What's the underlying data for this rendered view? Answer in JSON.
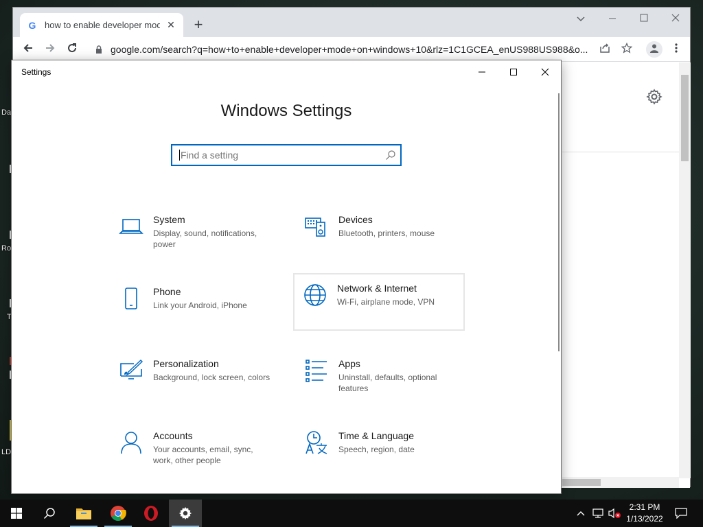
{
  "desktop": {
    "labels": [
      "Da",
      "Ro",
      "T",
      "LD"
    ]
  },
  "browser": {
    "tab_title": "how to enable developer mode c",
    "url": "google.com/search?q=how+to+enable+developer+mode+on+windows+10&rlz=1C1GCEA_enUS988US988&o...",
    "icons": {
      "tab_close": "close-icon",
      "new_tab": "plus-icon",
      "back": "back-arrow-icon",
      "forward": "forward-arrow-icon",
      "reload": "reload-icon",
      "lock": "lock-icon",
      "share": "share-icon",
      "bookmark": "star-icon",
      "profile": "profile-icon",
      "menu": "kebab-menu-icon",
      "settings": "gear-icon"
    }
  },
  "settings": {
    "window_title": "Settings",
    "heading": "Windows Settings",
    "search_placeholder": "Find a setting",
    "accent": "#0067c0",
    "tiles": [
      {
        "title": "System",
        "desc": "Display, sound, notifications, power",
        "icon": "laptop-icon"
      },
      {
        "title": "Devices",
        "desc": "Bluetooth, printers, mouse",
        "icon": "devices-icon"
      },
      {
        "title": "Phone",
        "desc": "Link your Android, iPhone",
        "icon": "phone-icon"
      },
      {
        "title": "Network & Internet",
        "desc": "Wi-Fi, airplane mode, VPN",
        "icon": "globe-icon"
      },
      {
        "title": "Personalization",
        "desc": "Background, lock screen, colors",
        "icon": "personalization-icon"
      },
      {
        "title": "Apps",
        "desc": "Uninstall, defaults, optional features",
        "icon": "apps-list-icon"
      },
      {
        "title": "Accounts",
        "desc": "Your accounts, email, sync, work, other people",
        "icon": "person-icon"
      },
      {
        "title": "Time & Language",
        "desc": "Speech, region, date",
        "icon": "time-language-icon"
      }
    ]
  },
  "taskbar": {
    "time": "2:31 PM",
    "date": "1/13/2022",
    "apps": [
      "start-icon",
      "search-icon",
      "file-explorer-icon",
      "chrome-icon",
      "opera-icon",
      "settings-gear-icon"
    ]
  }
}
